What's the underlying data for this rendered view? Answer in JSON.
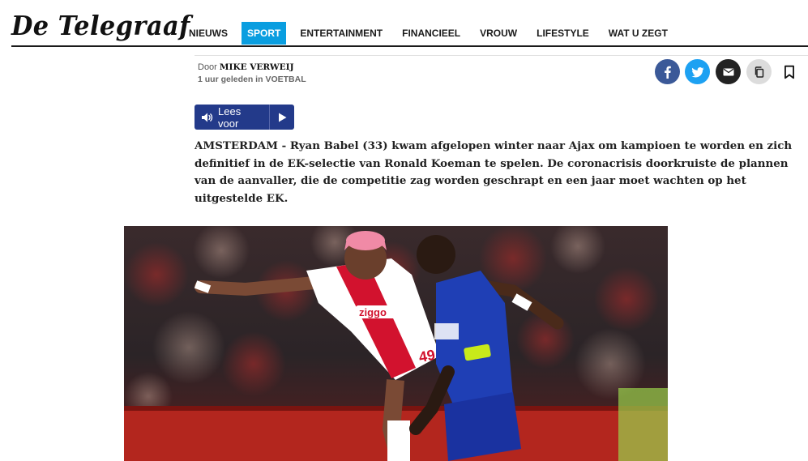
{
  "header": {
    "logo": "De Telegraaf",
    "nav": [
      {
        "label": "NIEUWS",
        "active": false
      },
      {
        "label": "SPORT",
        "active": true
      },
      {
        "label": "ENTERTAINMENT",
        "active": false
      },
      {
        "label": "FINANCIEEL",
        "active": false
      },
      {
        "label": "VROUW",
        "active": false
      },
      {
        "label": "LIFESTYLE",
        "active": false
      },
      {
        "label": "WAT U ZEGT",
        "active": false
      }
    ]
  },
  "byline": {
    "prefix": "Door",
    "author": "MIKE VERWEIJ",
    "time": "1 uur geleden in",
    "section": "VOETBAL"
  },
  "share_icons": [
    "facebook-icon",
    "twitter-icon",
    "mail-icon",
    "copy-icon",
    "bookmark-icon"
  ],
  "audio": {
    "label": "Lees voor"
  },
  "article": {
    "intro": "AMSTERDAM - Ryan Babel (33) kwam afgelopen winter naar Ajax om kampioen te worden en zich definitief in de EK-selectie van Ronald Koeman te spelen. De coronacrisis doorkruiste de plannen van de aanvaller, die de competitie zag worden geschrapt en een jaar moet wachten op het uitgestelde EK."
  },
  "photo": {
    "shirt_sponsor_left": "ziggo",
    "shirt_number": "49"
  },
  "colors": {
    "nav_active": "#0a9ee0",
    "audio_button": "#233a8a",
    "facebook": "#3b5998",
    "twitter": "#1da1f2"
  }
}
